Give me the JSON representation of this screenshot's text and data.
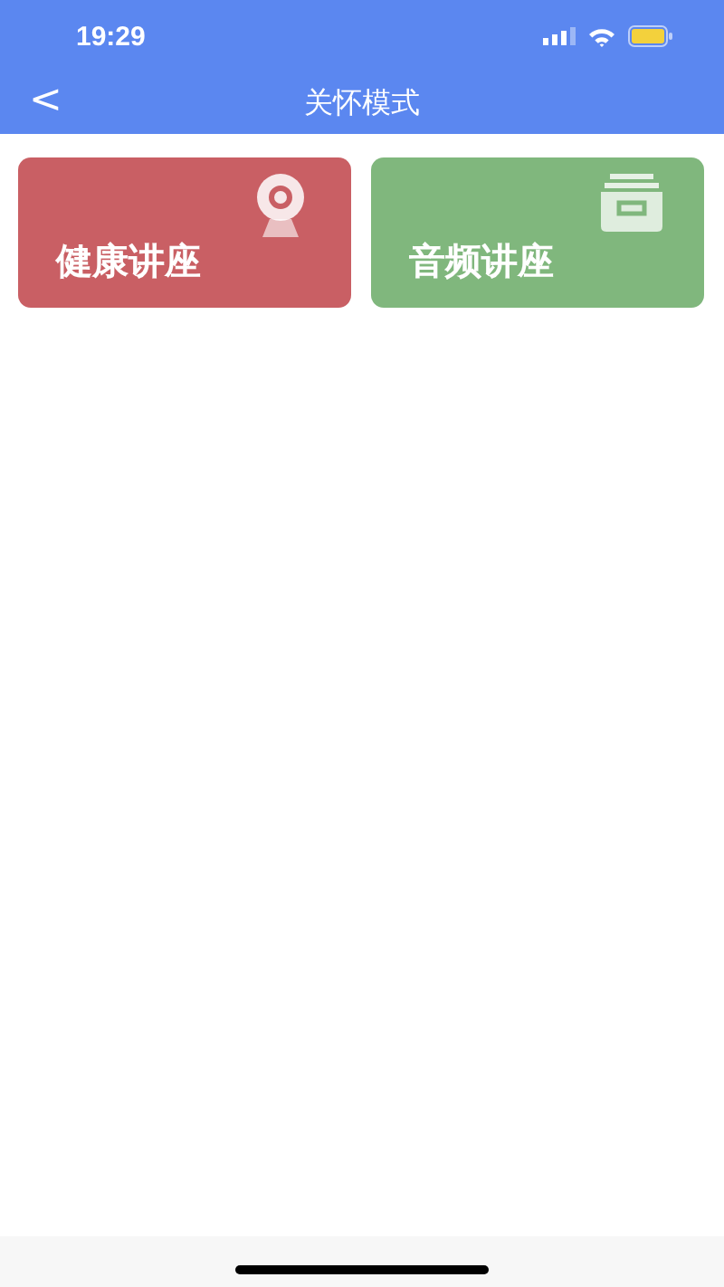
{
  "status_bar": {
    "time": "19:29"
  },
  "nav": {
    "title": "关怀模式",
    "back": "<"
  },
  "cards": [
    {
      "label": "健康讲座",
      "kind": "webcam",
      "color": "#c95f64"
    },
    {
      "label": "音频讲座",
      "kind": "archive",
      "color": "#80b77d"
    }
  ]
}
